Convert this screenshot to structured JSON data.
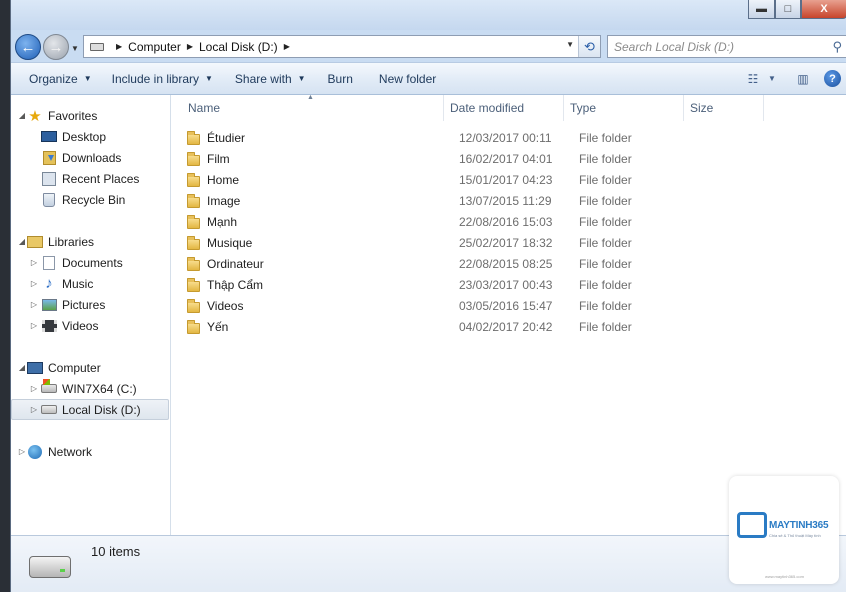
{
  "window": {
    "caption_buttons": {
      "minimize": "▬",
      "maximize": "□",
      "close": "X"
    }
  },
  "address": {
    "crumbs": [
      "Computer",
      "Local Disk (D:)"
    ],
    "search_placeholder": "Search Local Disk (D:)"
  },
  "toolbar": {
    "organize": "Organize",
    "include_in_library": "Include in library",
    "share_with": "Share with",
    "burn": "Burn",
    "new_folder": "New folder",
    "help": "?"
  },
  "nav": {
    "favorites": {
      "label": "Favorites",
      "items": [
        "Desktop",
        "Downloads",
        "Recent Places",
        "Recycle Bin"
      ]
    },
    "libraries": {
      "label": "Libraries",
      "items": [
        "Documents",
        "Music",
        "Pictures",
        "Videos"
      ]
    },
    "computer": {
      "label": "Computer",
      "items": [
        "WIN7X64 (C:)",
        "Local Disk (D:)"
      ]
    },
    "network": {
      "label": "Network"
    },
    "selected": "Local Disk (D:)"
  },
  "columns": [
    "Name",
    "Date modified",
    "Type",
    "Size"
  ],
  "files": [
    {
      "name": "Étudier",
      "date": "12/03/2017 00:11",
      "type": "File folder"
    },
    {
      "name": "Film",
      "date": "16/02/2017 04:01",
      "type": "File folder"
    },
    {
      "name": "Home",
      "date": "15/01/2017 04:23",
      "type": "File folder"
    },
    {
      "name": "Image",
      "date": "13/07/2015 11:29",
      "type": "File folder"
    },
    {
      "name": "Mạnh",
      "date": "22/08/2016 15:03",
      "type": "File folder"
    },
    {
      "name": "Musique",
      "date": "25/02/2017 18:32",
      "type": "File folder"
    },
    {
      "name": "Ordinateur",
      "date": "22/08/2015 08:25",
      "type": "File folder"
    },
    {
      "name": "Thập Cẩm",
      "date": "23/03/2017 00:43",
      "type": "File folder"
    },
    {
      "name": "Videos",
      "date": "03/05/2016 15:47",
      "type": "File folder"
    },
    {
      "name": "Yến",
      "date": "04/02/2017 20:42",
      "type": "File folder"
    }
  ],
  "details": {
    "count": "10 items"
  },
  "watermark": {
    "brand": "MAYTINH365",
    "tagline": "Chia sẻ & Thủ thuật Máy tính",
    "url": "www.maytinh365.com"
  }
}
